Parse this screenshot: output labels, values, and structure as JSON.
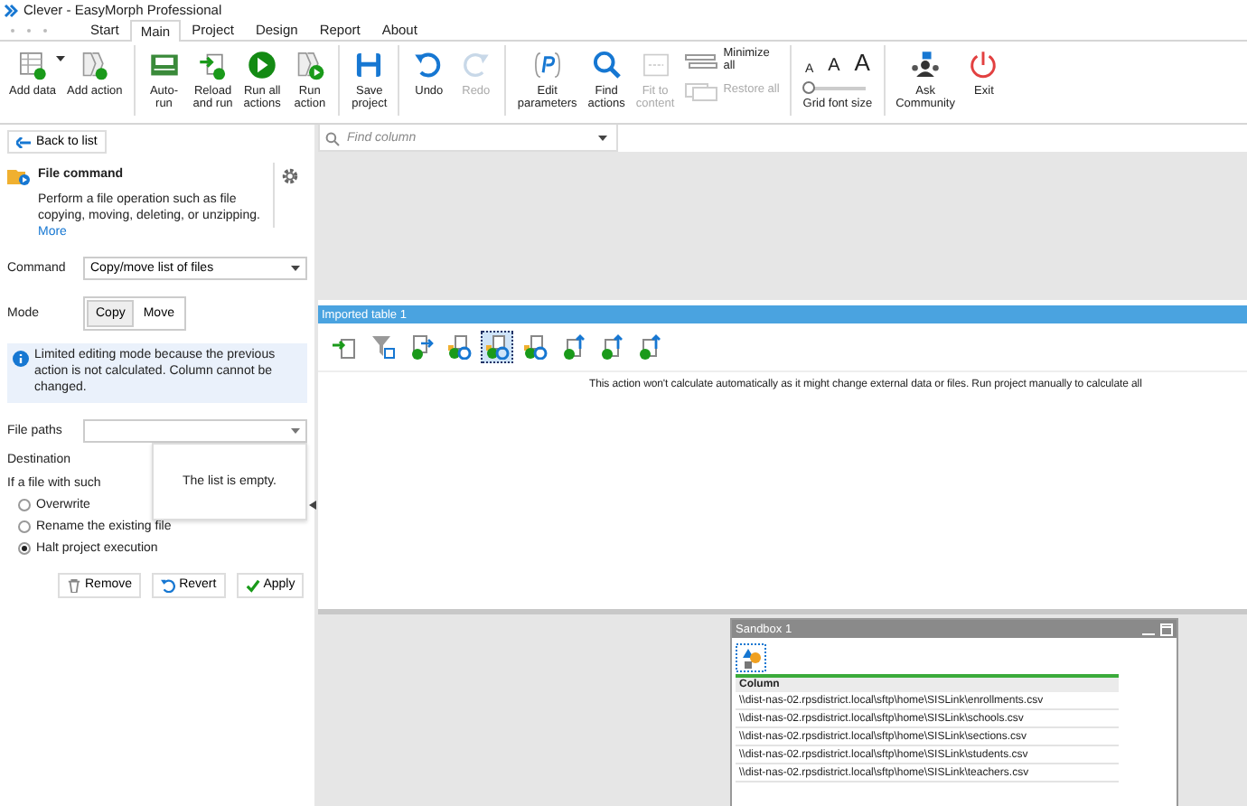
{
  "window": {
    "title": "Clever - EasyMorph Professional"
  },
  "tabs": [
    {
      "label": "Start",
      "selected": false
    },
    {
      "label": "Main",
      "selected": true
    },
    {
      "label": "Project",
      "selected": false
    },
    {
      "label": "Design",
      "selected": false
    },
    {
      "label": "Report",
      "selected": false
    },
    {
      "label": "About",
      "selected": false
    }
  ],
  "ribbon_groups": [
    {
      "items": [
        {
          "kind": "button",
          "label": "Add data",
          "dropdown": true,
          "disabled": false
        },
        {
          "kind": "button",
          "label": "Add action",
          "dropdown": false,
          "disabled": false
        }
      ]
    },
    {
      "items": [
        {
          "kind": "button",
          "label": "Auto-\nrun",
          "dropdown": false,
          "disabled": false
        },
        {
          "kind": "button",
          "label": "Reload\nand run",
          "dropdown": false,
          "disabled": false
        },
        {
          "kind": "button",
          "label": "Run all\nactions",
          "dropdown": false,
          "disabled": false
        },
        {
          "kind": "button",
          "label": "Run\naction",
          "dropdown": false,
          "disabled": false
        }
      ]
    },
    {
      "items": [
        {
          "kind": "button",
          "label": "Save\nproject",
          "dropdown": false,
          "disabled": false
        }
      ]
    },
    {
      "items": [
        {
          "kind": "button",
          "label": "Undo",
          "dropdown": false,
          "disabled": false
        },
        {
          "kind": "button",
          "label": "Redo",
          "dropdown": false,
          "disabled": true
        }
      ]
    },
    {
      "items": [
        {
          "kind": "button",
          "label": "Edit\nparameters",
          "dropdown": false,
          "disabled": false
        },
        {
          "kind": "button",
          "label": "Find\nactions",
          "dropdown": false,
          "disabled": false
        },
        {
          "kind": "button",
          "label": "Fit to\ncontent",
          "dropdown": false,
          "disabled": true
        },
        {
          "kind": "stack",
          "rows": [
            {
              "label": "Minimize\nall",
              "disabled": false
            },
            {
              "label": "Restore all",
              "disabled": true
            }
          ]
        }
      ]
    },
    {
      "items": [
        {
          "kind": "slider",
          "label": "Grid font size",
          "glyphs": [
            "A",
            "A",
            "A"
          ],
          "level": 0
        }
      ]
    },
    {
      "items": [
        {
          "kind": "button",
          "label": "Ask\nCommunity",
          "dropdown": false,
          "disabled": false
        },
        {
          "kind": "button",
          "label": "Exit",
          "dropdown": false,
          "disabled": false
        }
      ]
    }
  ],
  "left_panel": {
    "back_button": "Back to list",
    "title": "File command",
    "description": "Perform a file operation such as file copying, moving, deleting, or unzipping.",
    "more_link": "More",
    "command": {
      "label": "Command",
      "value": "Copy/move list of files"
    },
    "mode": {
      "label": "Mode",
      "options": [
        {
          "label": "Copy",
          "selected": true
        },
        {
          "label": "Move",
          "selected": false
        }
      ]
    },
    "info": "Limited editing mode because the previous action is not calculated. Column cannot be changed.",
    "file_paths": {
      "label": "File paths",
      "popup": "The list is empty."
    },
    "destination_label": "Destination",
    "if_exists_label": "If a file with such",
    "radios": [
      {
        "label": "Overwrite",
        "selected": false
      },
      {
        "label": "Rename the existing file",
        "selected": false
      },
      {
        "label": "Halt project execution",
        "selected": true
      }
    ],
    "buttons": [
      "Remove",
      "Revert",
      "Apply"
    ]
  },
  "find_column": {
    "placeholder": "Find column"
  },
  "table_panel": {
    "title": "Imported table 1",
    "action_icons": [
      {
        "selected": false
      },
      {
        "selected": false
      },
      {
        "selected": false
      },
      {
        "selected": false
      },
      {
        "selected": true
      },
      {
        "selected": false
      },
      {
        "selected": false
      },
      {
        "selected": false
      },
      {
        "selected": false
      }
    ],
    "message": "This action won't calculate automatically as it might change external data or files. Run project manually to calculate all"
  },
  "sandbox": {
    "title": "Sandbox 1",
    "columns": [
      "Column"
    ],
    "rows": [
      "\\\\dist-nas-02.rpsdistrict.local\\sftp\\home\\SISLink\\enrollments.csv",
      "\\\\dist-nas-02.rpsdistrict.local\\sftp\\home\\SISLink\\schools.csv",
      "\\\\dist-nas-02.rpsdistrict.local\\sftp\\home\\SISLink\\sections.csv",
      "\\\\dist-nas-02.rpsdistrict.local\\sftp\\home\\SISLink\\students.csv",
      "\\\\dist-nas-02.rpsdistrict.local\\sftp\\home\\SISLink\\teachers.csv"
    ]
  }
}
